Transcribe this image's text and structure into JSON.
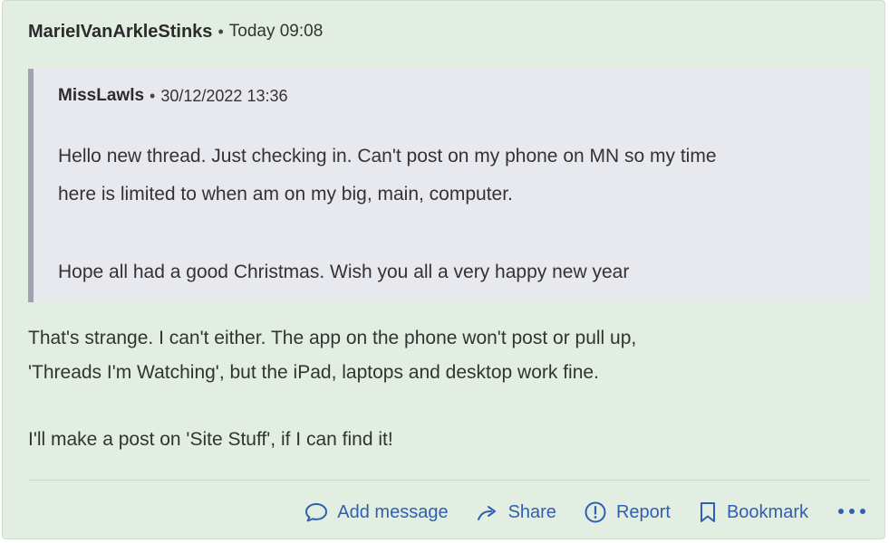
{
  "post": {
    "author": "MarieIVanArkleStinks",
    "separator": "•",
    "timestamp": "Today 09:08"
  },
  "quote": {
    "author": "MissLawls",
    "separator": "•",
    "timestamp": "30/12/2022 13:36",
    "lines": [
      "Hello new thread. Just checking in. Can't post on my phone on MN so my time",
      "here is limited to when am on my big, main, computer.",
      "Hope all had a good Christmas. Wish you all a very happy new year"
    ]
  },
  "reply": {
    "lines": [
      "That's strange. I can't either. The app on the phone won't post or pull up,",
      "'Threads I'm Watching', but the iPad, laptops and desktop work fine.",
      "I'll make a post on 'Site Stuff', if I can find it!"
    ]
  },
  "actions": {
    "add_message": "Add message",
    "share": "Share",
    "report": "Report",
    "bookmark": "Bookmark"
  },
  "colors": {
    "post_background": "#e3eee2",
    "quote_background": "#e8e9ee",
    "quote_border": "#9ea3ad",
    "action_link": "#2f5fb0"
  },
  "icons": {
    "add_message": "speech-bubble-icon",
    "share": "share-arrow-icon",
    "report": "exclamation-circle-icon",
    "bookmark": "bookmark-icon",
    "more": "more-dots-icon"
  }
}
